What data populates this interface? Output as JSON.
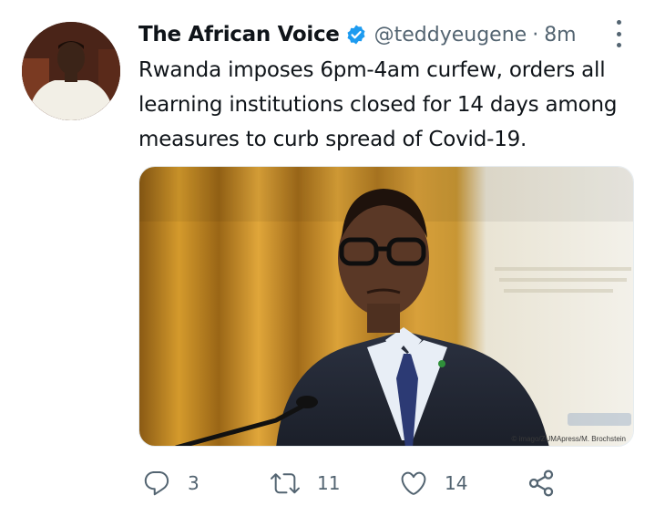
{
  "tweet": {
    "author": {
      "display_name": "The African Voice",
      "handle": "@teddyeugene",
      "verified": true,
      "avatar_icon": "user-avatar"
    },
    "separator": "·",
    "time": "8m",
    "text": "Rwanda imposes 6pm-4am curfew, orders all learning institutions closed for 14 days among measures to curb spread of Covid-19.",
    "media": {
      "credit": "© imago/ZUMApress/M. Brochstein"
    }
  },
  "actions": {
    "reply": {
      "icon": "reply-icon",
      "count": "3"
    },
    "retweet": {
      "icon": "retweet-icon",
      "count": "11"
    },
    "like": {
      "icon": "heart-icon",
      "count": "14"
    },
    "share": {
      "icon": "share-icon"
    }
  },
  "colors": {
    "text": "#0f1419",
    "secondary": "#536471",
    "verified_blue": "#1d9bf0"
  }
}
